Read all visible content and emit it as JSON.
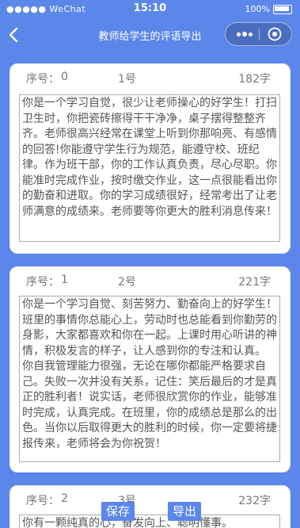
{
  "status_bar": {
    "carrier": "●●●●● WeChat",
    "time": "15:10",
    "battery": "100%"
  },
  "nav": {
    "title": "教师给学生的评语导出"
  },
  "cards": [
    {
      "no_label": "序号：",
      "no_value": "0",
      "name": "1号",
      "count": "182字",
      "text": "你是一个学习自觉，很少让老师操心的好学生！打扫卫生时，你把瓷砖擦得干干净净，桌子摆得整整齐齐。老师很高兴经常在课堂上听到你那响亮、有感情的回答!你能遵守学生行为规范，能遵守校、班纪律。作为班干部，你的工作认真负责，尽心尽职。你能准时完成作业，按时缴交作业，这一点很能看出你的勤奋和进取。你的学习成绩很好，经常考出了让老师满意的成绩来。老师要等你更大的胜利消息传来！"
    },
    {
      "no_label": "序号：",
      "no_value": "1",
      "name": "2号",
      "count": "221字",
      "text": "  你是一个学习自觉、刻苦努力、勤奋向上的好学生！班里的事情你总能心上，劳动时也总能看到你勤劳的身影，大家都喜欢和你在一起。上课时用心听讲的神情，积极发言的样子，让人感到你的专注和认真。 你自我管理能力很强，无论在哪你都能严格要求自己。失败一次并没有关系，记住：笑后最后的才是真正的胜利者！说实话，老师很欣赏你的作业，能够准时完成，认真完成。在班里，你的成绩总是那么的出色。当你以后取得更大的胜利的时候，你一定要将捷报传来，老师将会为你祝贺！"
    },
    {
      "no_label": "序号：",
      "no_value": "2",
      "name": "3号",
      "count": "232字",
      "text": "你有一颗纯真的心，奋发向上、聪明懂事。"
    }
  ],
  "buttons": {
    "save": "保存",
    "export": "导出"
  }
}
